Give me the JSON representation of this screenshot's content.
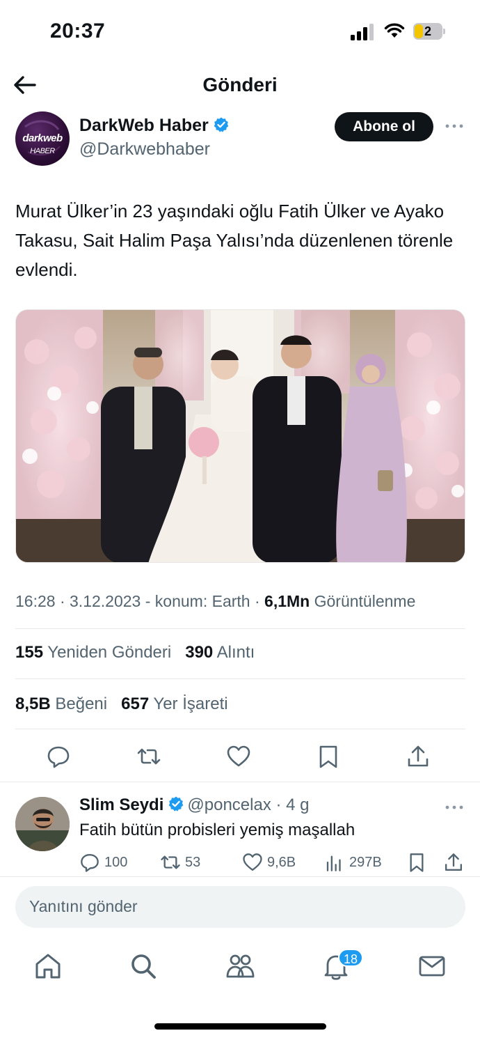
{
  "status_bar": {
    "time": "20:37",
    "battery_level": "2",
    "icons": [
      "cellular-signal-icon",
      "wifi-icon",
      "battery-icon"
    ]
  },
  "header": {
    "title": "Gönderi",
    "back_icon": "arrow-left-icon"
  },
  "post": {
    "author": {
      "display_name": "DarkWeb Haber",
      "handle": "@Darkwebhaber",
      "verified": true,
      "avatar_logo_text": "darkweb",
      "avatar_logo_sub": "HABER"
    },
    "follow_label": "Abone ol",
    "text": "Murat Ülker’in 23 yaşındaki oğlu Fatih Ülker ve Ayako Takasu, Sait Halim Paşa Yalısı’nda düzenlenen törenle evlendi.",
    "meta": {
      "time": "16:28",
      "separator1": " · ",
      "date": "3.12.2023",
      "location": " - konum: Earth",
      "separator2": " · ",
      "views": "6,1Mn",
      "views_label": " Görüntülenme"
    },
    "stats": {
      "reposts": "155",
      "reposts_label": " Yeniden Gönderi",
      "quotes": "390",
      "quotes_label": " Alıntı",
      "likes": "8,5B",
      "likes_label": " Beğeni",
      "bookmarks": "657",
      "bookmarks_label": " Yer İşareti"
    },
    "actions": [
      "reply-icon",
      "repost-icon",
      "like-icon",
      "bookmark-icon",
      "share-icon"
    ]
  },
  "reply": {
    "display_name": "Slim Seydi",
    "handle": "@poncelax",
    "age": " · 4 g",
    "verified": true,
    "text": "Fatih bütün probisleri yemiş maşallah",
    "counts": {
      "replies": "100",
      "reposts": "53",
      "likes": "9,6B",
      "views": "297B"
    }
  },
  "composer": {
    "placeholder": "Yanıtını gönder"
  },
  "tab_bar": {
    "tabs": [
      "home-icon",
      "search-icon",
      "communities-icon",
      "notifications-icon",
      "messages-icon"
    ],
    "notification_count": "18"
  },
  "colors": {
    "text_primary": "#0f1419",
    "text_secondary": "#536471",
    "accent": "#1d9bf0",
    "divider": "#e7e9ea",
    "follow_button": "#0f1419"
  }
}
